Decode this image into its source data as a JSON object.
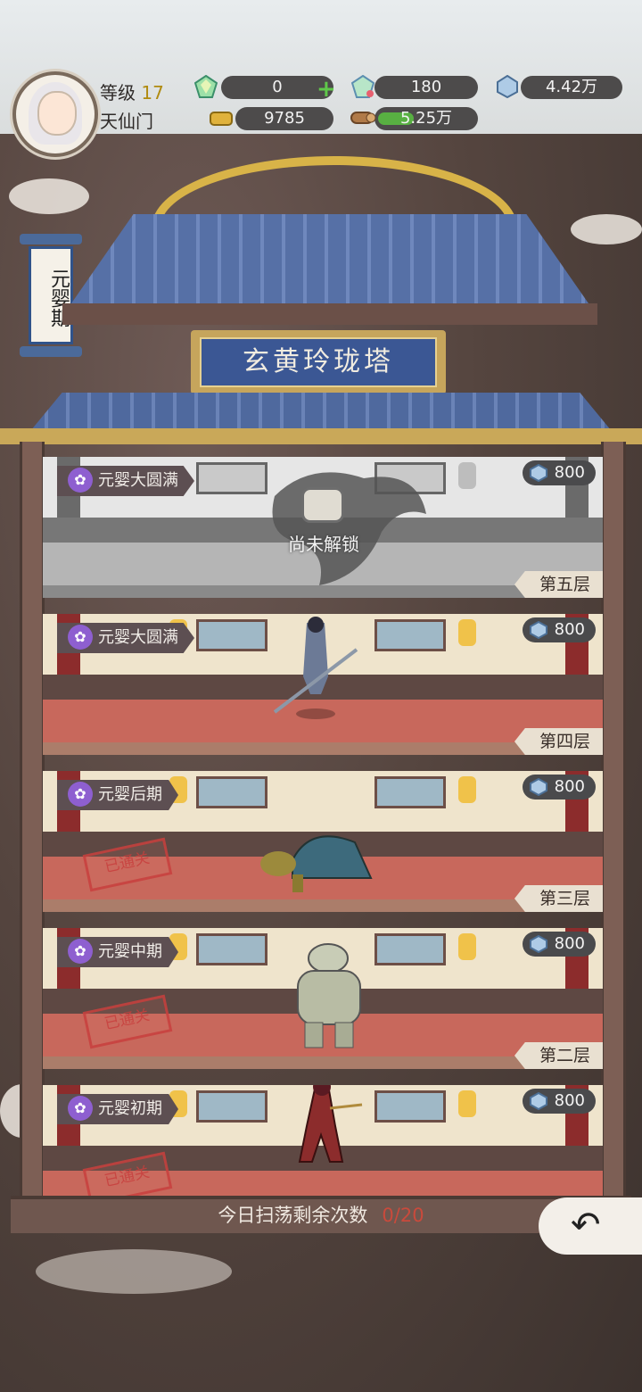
{
  "header": {
    "level_label": "等级",
    "level_value": "17",
    "sect": "天仙门",
    "resources": {
      "jade": "0",
      "crystal": "180",
      "spirit_stone": "4.42万",
      "gold": "9785",
      "wood": "5.25万"
    }
  },
  "realm_banner": "元婴期",
  "tower_title": "玄黄玲珑塔",
  "floors": [
    {
      "realm": "元婴大圆满",
      "cost": "800",
      "label": "第五层",
      "locked_text": "尚未解锁"
    },
    {
      "realm": "元婴大圆满",
      "cost": "800",
      "label": "第四层"
    },
    {
      "realm": "元婴后期",
      "cost": "800",
      "label": "第三层",
      "stamp": "已通关"
    },
    {
      "realm": "元婴中期",
      "cost": "800",
      "label": "第二层",
      "stamp": "已通关"
    },
    {
      "realm": "元婴初期",
      "cost": "800",
      "stamp": "已通关"
    }
  ],
  "sweep": {
    "label": "今日扫荡剩余次数",
    "count": "0/20"
  },
  "colors": {
    "accent_gold": "#d8b348",
    "roof_blue": "#5670a6",
    "stamp_red": "#c9403e"
  }
}
